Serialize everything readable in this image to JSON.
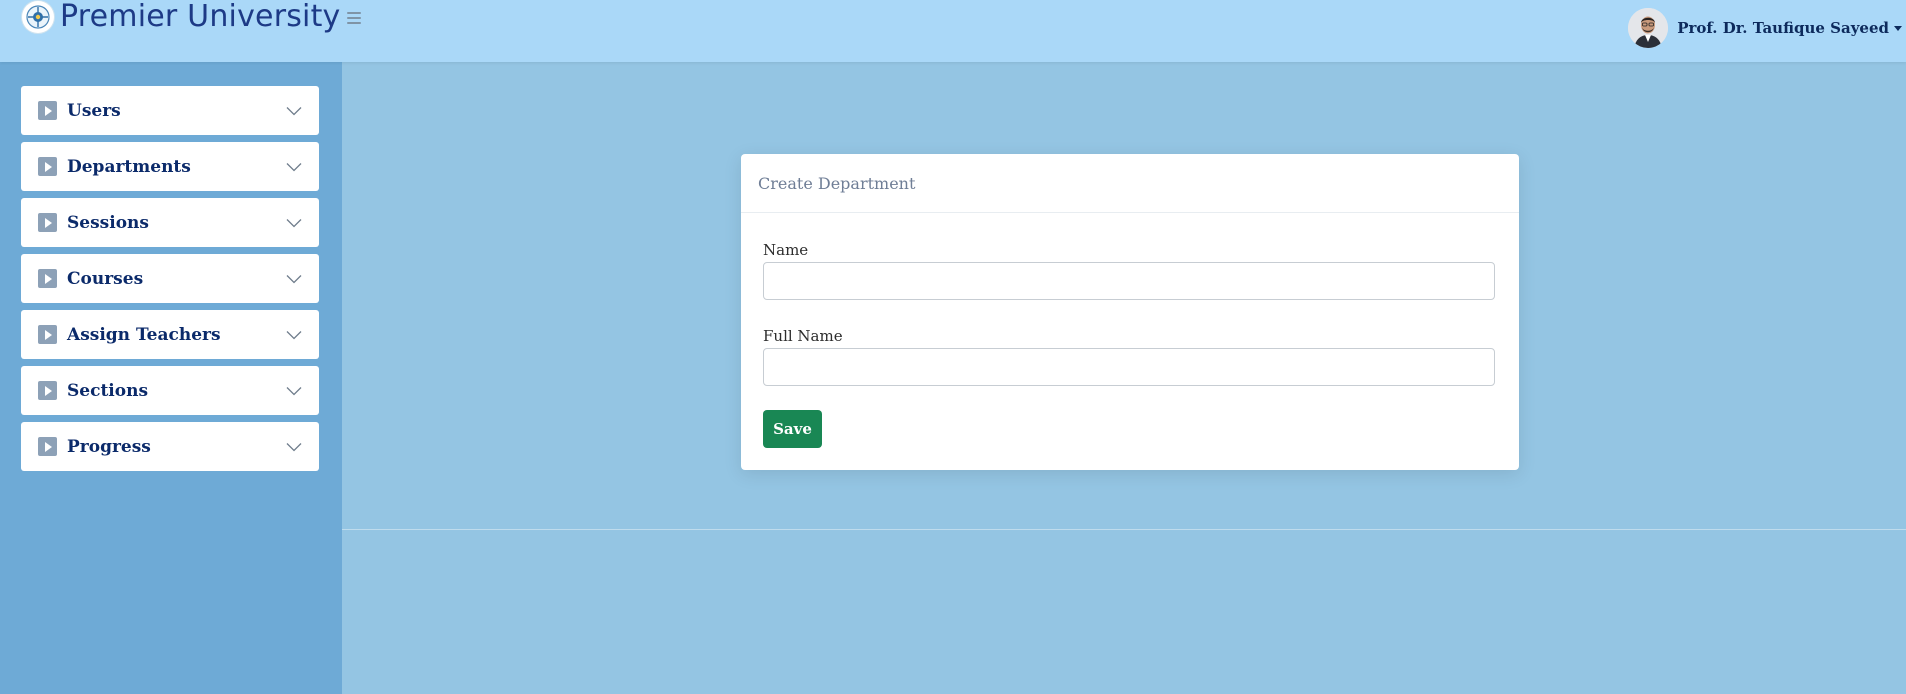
{
  "header": {
    "brand": "Premier University",
    "logo_icon": "university-logo-icon",
    "menu_icon": "hamburger-icon",
    "user_name": "Prof. Dr. Taufique Sayeed",
    "user_caret_icon": "caret-down-icon"
  },
  "sidebar": {
    "items": [
      {
        "label": "Users",
        "icon": "play-icon",
        "chevron": "chevron-down-icon"
      },
      {
        "label": "Departments",
        "icon": "play-icon",
        "chevron": "chevron-down-icon"
      },
      {
        "label": "Sessions",
        "icon": "play-icon",
        "chevron": "chevron-down-icon"
      },
      {
        "label": "Courses",
        "icon": "play-icon",
        "chevron": "chevron-down-icon"
      },
      {
        "label": "Assign Teachers",
        "icon": "play-icon",
        "chevron": "chevron-down-icon"
      },
      {
        "label": "Sections",
        "icon": "play-icon",
        "chevron": "chevron-down-icon"
      },
      {
        "label": "Progress",
        "icon": "play-icon",
        "chevron": "chevron-down-icon"
      }
    ]
  },
  "form": {
    "title": "Create Department",
    "name_label": "Name",
    "name_value": "",
    "full_name_label": "Full Name",
    "full_name_value": "",
    "save_label": "Save"
  },
  "colors": {
    "topbar": "#aad8f8",
    "sidebar": "#6eaad6",
    "main_bg": "#94c5e3",
    "brand_text": "#1d3a86",
    "save_button": "#198754"
  }
}
